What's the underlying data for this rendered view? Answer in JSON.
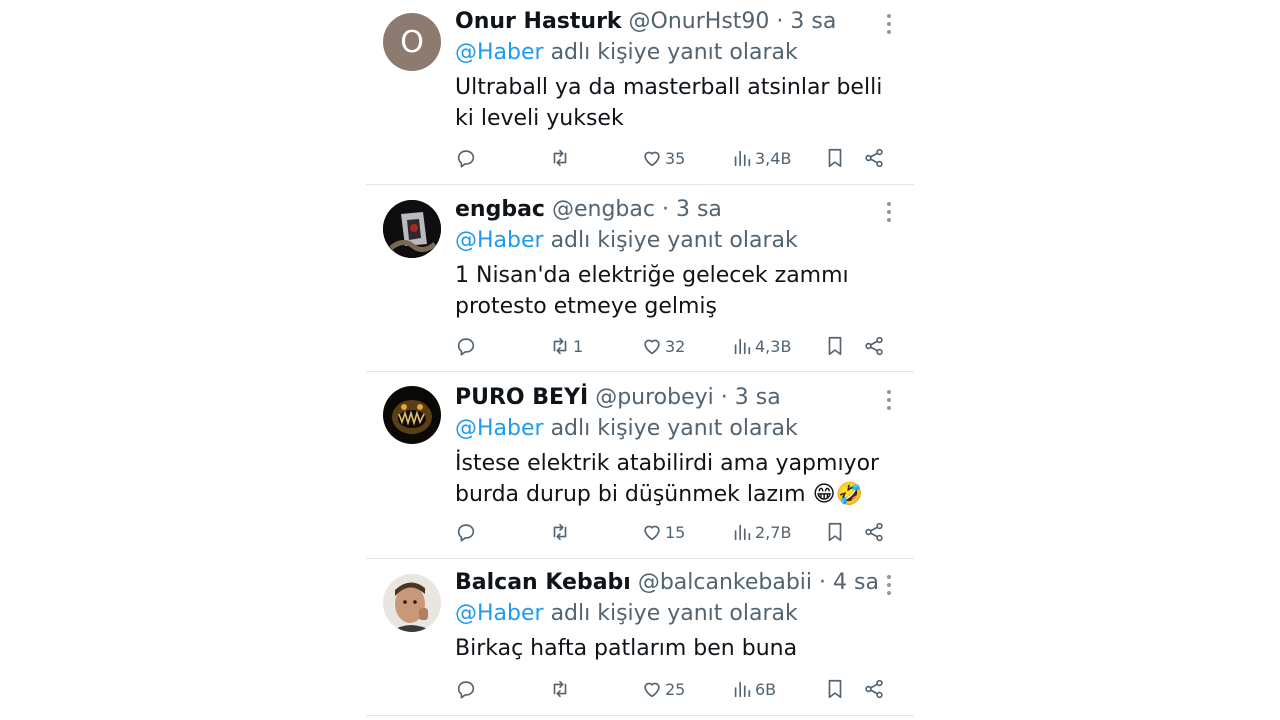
{
  "tweets": [
    {
      "avatar_letter": "O",
      "display_name": "Onur Hasturk",
      "handle": "@OnurHst90",
      "separator": "·",
      "time": "3 sa",
      "reply_mention": "@Haber",
      "reply_text": "adlı kişiye yanıt olarak",
      "text": "Ultraball ya da masterball atsinlar belli ki leveli yuksek",
      "retweets": "",
      "likes": "35",
      "views": "3,4B"
    },
    {
      "avatar_letter": "",
      "display_name": "engbac",
      "handle": "@engbac",
      "separator": "·",
      "time": "3 sa",
      "reply_mention": "@Haber",
      "reply_text": "adlı kişiye yanıt olarak",
      "text": "1 Nisan'da elektriğe gelecek zammı protesto etmeye gelmiş",
      "retweets": "1",
      "likes": "32",
      "views": "4,3B"
    },
    {
      "avatar_letter": "",
      "display_name": "PURO BEYİ",
      "handle": "@purobeyi",
      "separator": "·",
      "time": "3 sa",
      "reply_mention": "@Haber",
      "reply_text": "adlı kişiye yanıt olarak",
      "text": "İstese elektrik atabilirdi ama yapmıyor burda durup bi düşünmek lazım 😁🤣",
      "retweets": "",
      "likes": "15",
      "views": "2,7B"
    },
    {
      "avatar_letter": "",
      "display_name": "Balcan Kebabı",
      "handle": "@balcankebabii",
      "separator": "·",
      "time": "4 sa",
      "reply_mention": "@Haber",
      "reply_text": "adlı kişiye yanıt olarak",
      "text": "Birkaç hafta patlarım ben buna",
      "retweets": "",
      "likes": "25",
      "views": "6B"
    }
  ],
  "colors": {
    "link": "#1d9bf0",
    "secondary": "#536471",
    "primary_text": "#0f1419",
    "divider": "#e6e6e6"
  },
  "icons": {
    "reply": "reply-icon",
    "retweet": "retweet-icon",
    "like": "heart-icon",
    "views": "views-icon",
    "bookmark": "bookmark-icon",
    "share": "share-icon",
    "more": "more-options-icon"
  }
}
